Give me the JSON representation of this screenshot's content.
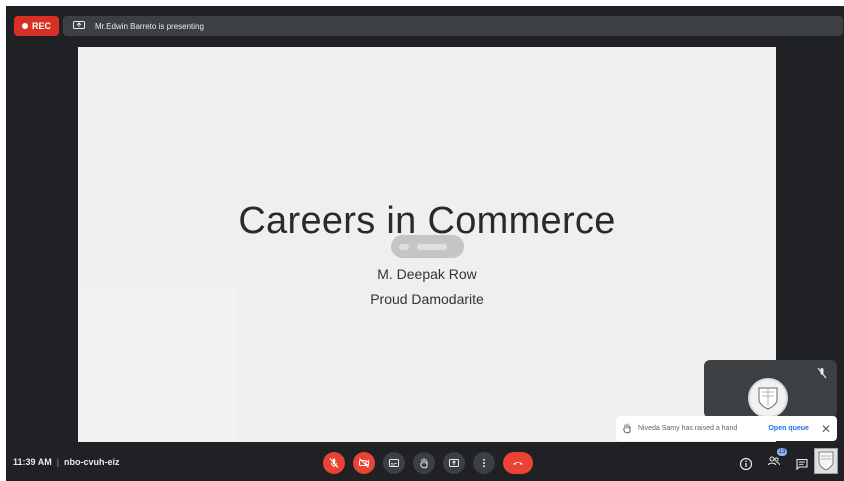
{
  "recording": {
    "label": "REC"
  },
  "presenter_bar": {
    "text": "Mr.Edwin Barreto is presenting"
  },
  "slide": {
    "title": "Careers in Commerce",
    "lines": [
      "M. Deepak Row",
      "Proud Damodarite"
    ]
  },
  "notification": {
    "text": "Niveda Samy has raised a hand",
    "action": "Open queue"
  },
  "meeting": {
    "time": "11:39 AM",
    "separator": "|",
    "code": "nbo-cvuh-eiz"
  },
  "participants": {
    "count": "13"
  },
  "controls": [
    {
      "name": "mic-toggle-button",
      "icon": "mic-off-icon"
    },
    {
      "name": "camera-toggle-button",
      "icon": "camera-off-icon"
    },
    {
      "name": "captions-button",
      "icon": "captions-icon"
    },
    {
      "name": "raise-hand-button",
      "icon": "hand-icon"
    },
    {
      "name": "present-button",
      "icon": "present-icon"
    },
    {
      "name": "more-options-button",
      "icon": "more-vert-icon"
    },
    {
      "name": "leave-call-button",
      "icon": "call-end-icon"
    }
  ],
  "colors": {
    "background": "#202124",
    "bar": "#3c4043",
    "danger": "#ea4335",
    "rec": "#d93025",
    "link": "#1a73e8",
    "slide": "#efefef"
  }
}
